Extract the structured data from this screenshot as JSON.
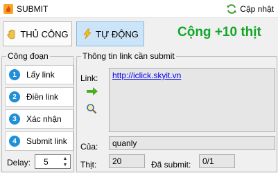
{
  "titlebar": {
    "title": "SUBMIT",
    "update_label": "Cập nhật",
    "app_icon": "flame-icon",
    "update_icon": "refresh-icon"
  },
  "modes": {
    "manual_label": "THỦ CÔNG",
    "manual_icon": "hand-icon",
    "auto_label": "TỰ ĐỘNG",
    "auto_icon": "lightning-icon",
    "active": "auto"
  },
  "bonus_text": "Cộng +10 thịt",
  "colors": {
    "bonus": "#11a629",
    "step_badge": "#1f8fd8",
    "active_mode_bg": "#cce4f7",
    "link": "#0000ee"
  },
  "steps": {
    "legend": "Công đoạn",
    "items": [
      {
        "num": "1",
        "label": "Lấy link"
      },
      {
        "num": "2",
        "label": "Điền link"
      },
      {
        "num": "3",
        "label": "Xác nhận"
      },
      {
        "num": "4",
        "label": "Submit link"
      }
    ]
  },
  "delay": {
    "label": "Delay:",
    "value": "5"
  },
  "info": {
    "legend": "Thông tin link cần submit",
    "link_label": "Link:",
    "link_value": "http://iclick.skyit.vn",
    "owner_label": "Của:",
    "owner_value": "quanly",
    "thit_label": "Thịt:",
    "thit_value": "20",
    "submitted_label": "Đã submit:",
    "submitted_value": "0/1"
  }
}
